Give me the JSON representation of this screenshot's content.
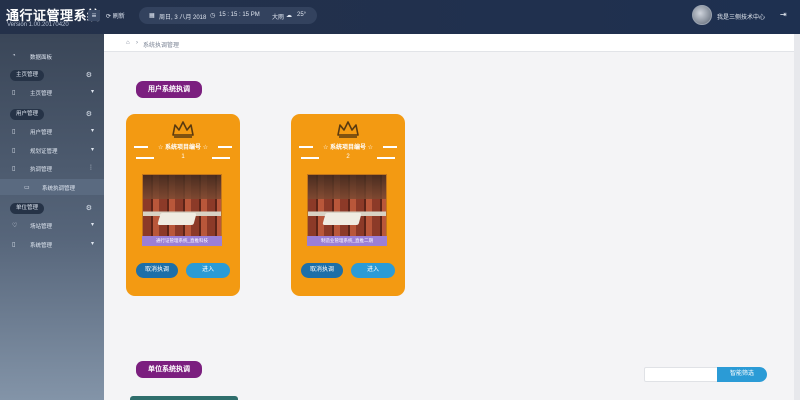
{
  "header": {
    "app_title": "通行证管理系统",
    "version": "Version 1.00.20170420",
    "refresh_label": "刷新",
    "date_text": "周日, 3 八月 2018",
    "time_text": "15 : 15 : 15 PM",
    "weather_text": "大雨",
    "temperature": "25°",
    "user_name": "我是三侧技术中心"
  },
  "sidebar": {
    "home_label": "数据面板",
    "groups": [
      {
        "label": "主页管理",
        "items": [
          {
            "label": "主页管理"
          }
        ]
      },
      {
        "label": "用户管理",
        "items": [
          {
            "label": "用户管理"
          },
          {
            "label": "规划证管理"
          },
          {
            "label": "执调管理"
          }
        ]
      },
      {
        "label": "单位管理",
        "items": [
          {
            "label": "场站管理"
          },
          {
            "label": "系统管理"
          }
        ]
      }
    ],
    "active_sub_label": "系统执调管理"
  },
  "breadcrumb": {
    "current": "系统执调管理"
  },
  "sections": {
    "user_system_label": "用户系统执调",
    "unit_system_label": "单位系统执调"
  },
  "cards": [
    {
      "title": "系统项目编号",
      "number": "1",
      "caption": "通行证管理系统_直推科技",
      "cancel_label": "取消执调",
      "enter_label": "进入"
    },
    {
      "title": "系统项目编号",
      "number": "2",
      "caption": "制造业管理系统_直推二期",
      "cancel_label": "取消执调",
      "enter_label": "进入"
    }
  ],
  "search": {
    "placeholder": "",
    "button_label": "智能筛选"
  },
  "colors": {
    "accent_orange": "#f39a12",
    "pill_purple": "#7b1f7f",
    "button_blue": "#2b9bd6",
    "topbar_dark": "#24314a"
  }
}
